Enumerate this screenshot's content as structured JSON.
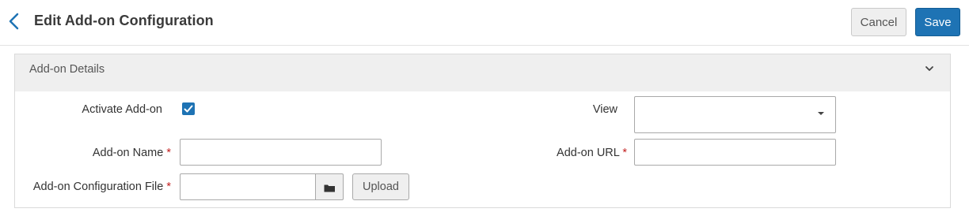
{
  "header": {
    "title": "Edit Add-on Configuration",
    "cancel_label": "Cancel",
    "save_label": "Save"
  },
  "section": {
    "title": "Add-on Details"
  },
  "form": {
    "activate_label": "Activate Add-on",
    "activate_checked": true,
    "name_label": "Add-on Name",
    "name_value": "",
    "config_file_label": "Add-on Configuration File",
    "config_file_value": "",
    "upload_label": "Upload",
    "view_label": "View",
    "view_value": "",
    "url_label": "Add-on URL",
    "url_value": "",
    "required_marker": "*"
  },
  "colors": {
    "accent": "#1e73b4",
    "required": "#c21f1f"
  },
  "icons": [
    "back-arrow-icon",
    "chevron-down-icon",
    "checkmark-icon",
    "caret-down-icon",
    "folder-icon"
  ]
}
